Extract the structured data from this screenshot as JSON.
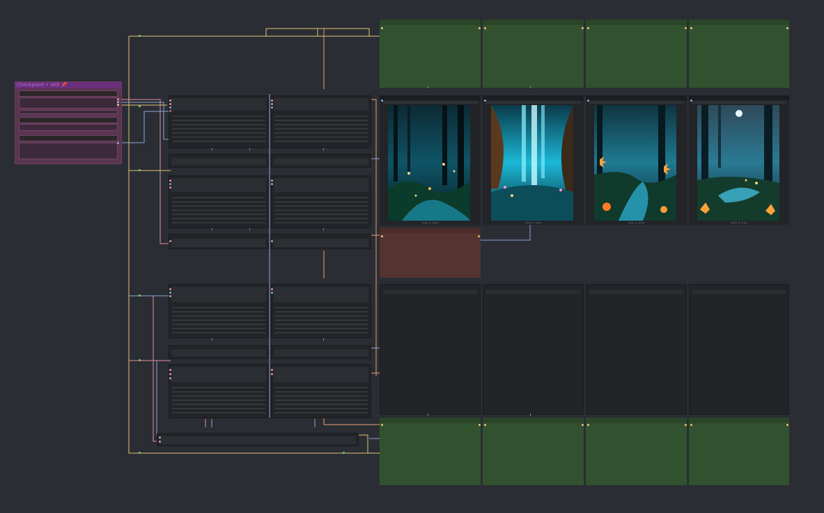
{
  "app": {
    "name": "node-graph canvas"
  },
  "pinned_node": {
    "title": "Checkpoint • VAE",
    "pin_icon": "pin-icon"
  },
  "image_previews": [
    {
      "caption": "••• • •••",
      "scene": "forest-stream-fireflies"
    },
    {
      "caption": "••• • •••",
      "scene": "cavern-waterfall"
    },
    {
      "caption": "••• • •••",
      "scene": "forest-river-butterflies"
    },
    {
      "caption": "••• • •••",
      "scene": "moonlit-forest-stream"
    }
  ],
  "colors": {
    "canvas_bg": "#2a2d33",
    "node_bg": "#222428",
    "output_group": "#32522f",
    "error_node": "#553331",
    "pinned_group": "#5a3550",
    "wire_yellow": "#e6c27a",
    "wire_pink": "#e78fa3",
    "wire_blue": "#8fa8d8",
    "wire_orange": "#e8a070"
  }
}
